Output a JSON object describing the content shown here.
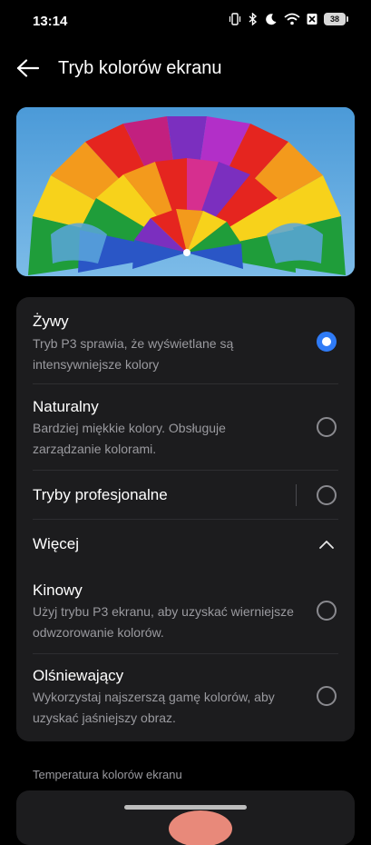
{
  "status_bar": {
    "time": "13:14",
    "battery": "38",
    "icons": [
      "vibrate-icon",
      "bluetooth-icon",
      "moon-icon",
      "wifi-icon",
      "no-sim-icon",
      "battery-icon"
    ]
  },
  "header": {
    "back_icon": "arrow-left-icon",
    "title": "Tryb kolorów ekranu"
  },
  "preview": {
    "image": "rainbow-parachute-photo",
    "sky_color": "#62acdf"
  },
  "options": [
    {
      "title": "Żywy",
      "description": "Tryb P3 sprawia, że wyświetlane są intensywniejsze kolory",
      "selected": true
    },
    {
      "title": "Naturalny",
      "description": "Bardziej miękkie kolory. Obsługuje zarządzanie kolorami.",
      "selected": false
    },
    {
      "title": "Tryby profesjonalne",
      "selected": false
    }
  ],
  "more": {
    "label": "Więcej",
    "icon": "chevron-up-icon",
    "expanded": true
  },
  "more_options": [
    {
      "title": "Kinowy",
      "description": "Użyj trybu P3 ekranu, aby uzyskać wierniejsze odwzorowanie kolorów.",
      "selected": false
    },
    {
      "title": "Olśniewający",
      "description": "Wykorzystaj najszerszą gamę kolorów, aby uzyskać jaśniejszy obraz.",
      "selected": false
    }
  ],
  "temperature": {
    "section_label": "Temperatura kolorów ekranu"
  },
  "colors": {
    "accent": "#2f7bf6",
    "card": "#1c1c1e",
    "background": "#000000",
    "secondary_text": "#9a9a9f"
  }
}
